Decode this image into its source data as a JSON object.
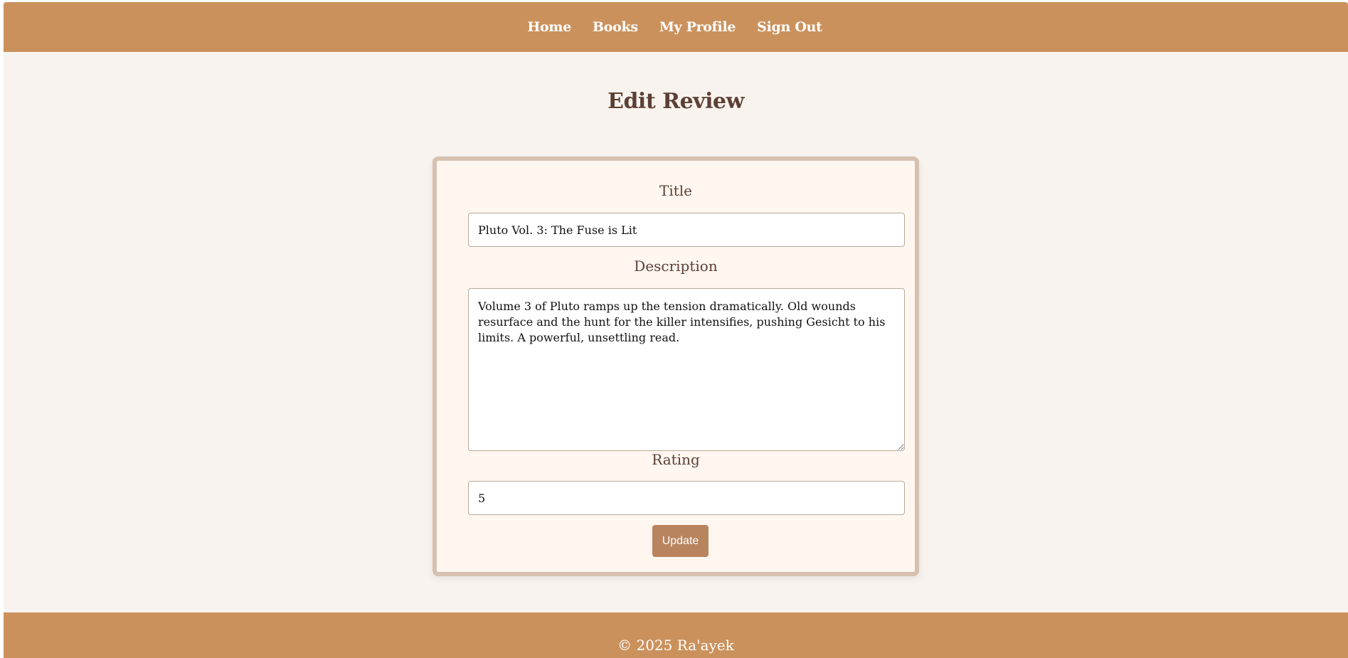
{
  "nav": {
    "items": [
      {
        "label": "Home"
      },
      {
        "label": "Books"
      },
      {
        "label": "My Profile"
      },
      {
        "label": "Sign Out"
      }
    ]
  },
  "page": {
    "title": "Edit Review"
  },
  "form": {
    "title_label": "Title",
    "title_value": "Pluto Vol. 3: The Fuse is Lit",
    "description_label": "Description",
    "description_value": "Volume 3 of Pluto ramps up the tension dramatically. Old wounds resurface and the hunt for the killer intensifies, pushing Gesicht to his limits. A powerful, unsettling read.",
    "rating_label": "Rating",
    "rating_value": "5",
    "submit_label": "Update"
  },
  "footer": {
    "copyright": "© 2025 Ra'ayek"
  },
  "colors": {
    "brand": "#cb915c",
    "background": "#f8f3ef",
    "card": "#fff6f0",
    "card_border": "#d6c1b0",
    "heading": "#5c4033",
    "button": "#b8845e"
  }
}
